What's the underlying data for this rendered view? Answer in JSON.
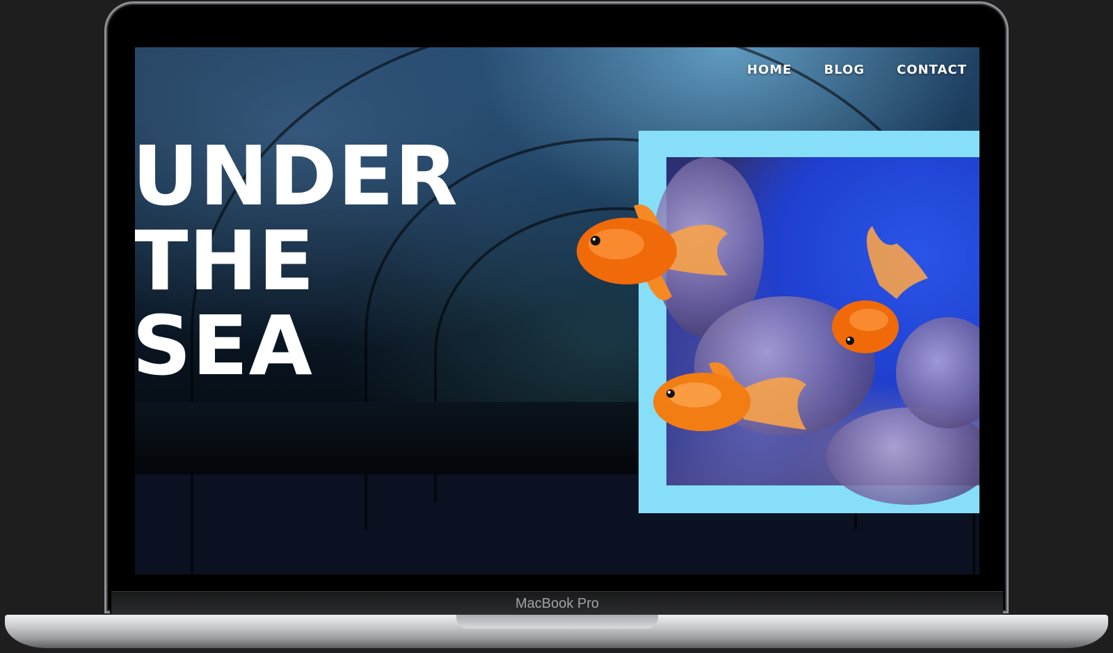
{
  "device": {
    "label": "MacBook Pro"
  },
  "nav": {
    "items": [
      {
        "label": "HOME"
      },
      {
        "label": "BLOG"
      },
      {
        "label": "CONTACT"
      }
    ]
  },
  "hero": {
    "title_lines": [
      "UNDER",
      "THE",
      "SEA"
    ]
  },
  "colors": {
    "frame_accent": "#86def8",
    "footer_bg": "#0b1120",
    "fish": "#f07a10"
  }
}
